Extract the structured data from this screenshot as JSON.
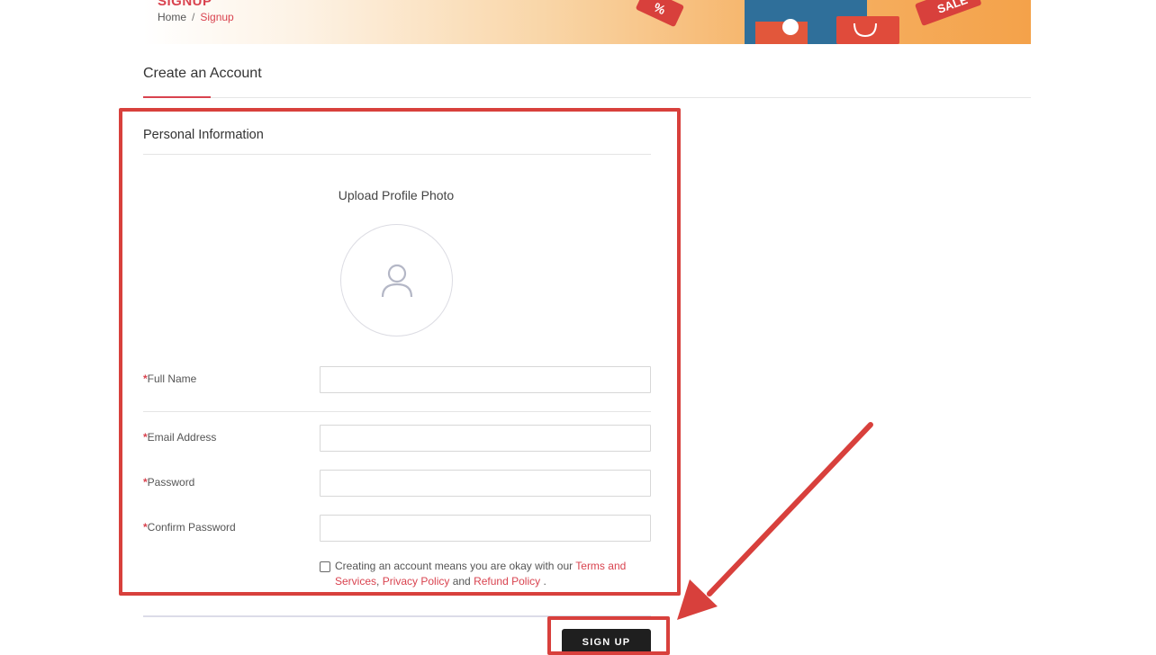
{
  "banner": {
    "title": "SIGNUP",
    "breadcrumb": {
      "home": "Home",
      "separator": "/",
      "current": "Signup"
    },
    "tag_text_1": "%",
    "tag_text_2": "SALE"
  },
  "page_title": "Create an Account",
  "section_title": "Personal Information",
  "upload": {
    "label": "Upload Profile Photo",
    "icon": "user-icon"
  },
  "fields": [
    {
      "required_mark": "*",
      "label": "Full Name",
      "value": ""
    },
    {
      "required_mark": "*",
      "label": "Email Address",
      "value": ""
    },
    {
      "required_mark": "*",
      "label": "Password",
      "value": ""
    },
    {
      "required_mark": "*",
      "label": "Confirm Password",
      "value": ""
    }
  ],
  "terms": {
    "checked": false,
    "prefix": "Creating an account means you are okay with our ",
    "link_terms": "Terms and Services",
    "sep1": ", ",
    "link_privacy": "Privacy Policy",
    "and": " and ",
    "link_refund": "Refund Policy",
    "suffix": " ."
  },
  "signup_button": "SIGN UP",
  "colors": {
    "accent": "#d9434f",
    "annotation": "#d8403c",
    "button": "#1f1f1f"
  }
}
